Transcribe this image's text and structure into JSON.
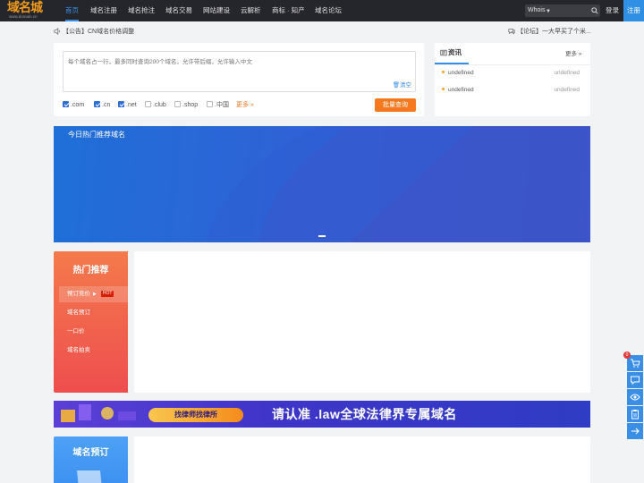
{
  "nav": {
    "logo_main": "域名城",
    "logo_sub": "www.domain.cn",
    "items": [
      "首页",
      "域名注册",
      "域名抢注",
      "域名交易",
      "网站建设",
      "云解析",
      "商标 · 知产",
      "域名论坛"
    ],
    "whois_label": "Whois",
    "login": "登录",
    "register": "注册"
  },
  "notice": {
    "left": "【公告】CN域名价格调整",
    "right": "【论坛】一大早买了个米..."
  },
  "search": {
    "placeholder": "每个域名占一行，最多同时查询200个域名，允许带后缀，允许输入中文",
    "clear": "清空",
    "tlds": [
      {
        "label": ".com",
        "checked": true
      },
      {
        "label": ".cn",
        "checked": true
      },
      {
        "label": ".net",
        "checked": true
      },
      {
        "label": ".club",
        "checked": false
      },
      {
        "label": ".shop",
        "checked": false
      },
      {
        "label": ".中国",
        "checked": false
      }
    ],
    "more": "更多 »",
    "batch_button": "批量查询"
  },
  "news": {
    "tab": "资讯",
    "more": "更多 »",
    "items": [
      {
        "title": "undefined",
        "date": "undefined"
      },
      {
        "title": "undefined",
        "date": "undefined"
      }
    ]
  },
  "banner": {
    "title": "今日热门推荐域名"
  },
  "hot": {
    "title": "热门推荐",
    "items": [
      "预订竞价",
      "域名预订",
      "一口价",
      "域名拍卖"
    ],
    "badge": "HOT"
  },
  "ad": {
    "button": "找律师找律所",
    "text": "请认准  .law全球法律界专属域名"
  },
  "preorder": {
    "title": "域名预订"
  },
  "toolbar": {
    "badge": "0"
  },
  "colors": {
    "accent": "#3a8ee6",
    "orange": "#f57a1f",
    "hot_red": "#ee4e4e",
    "nav_bg": "#25262b"
  }
}
